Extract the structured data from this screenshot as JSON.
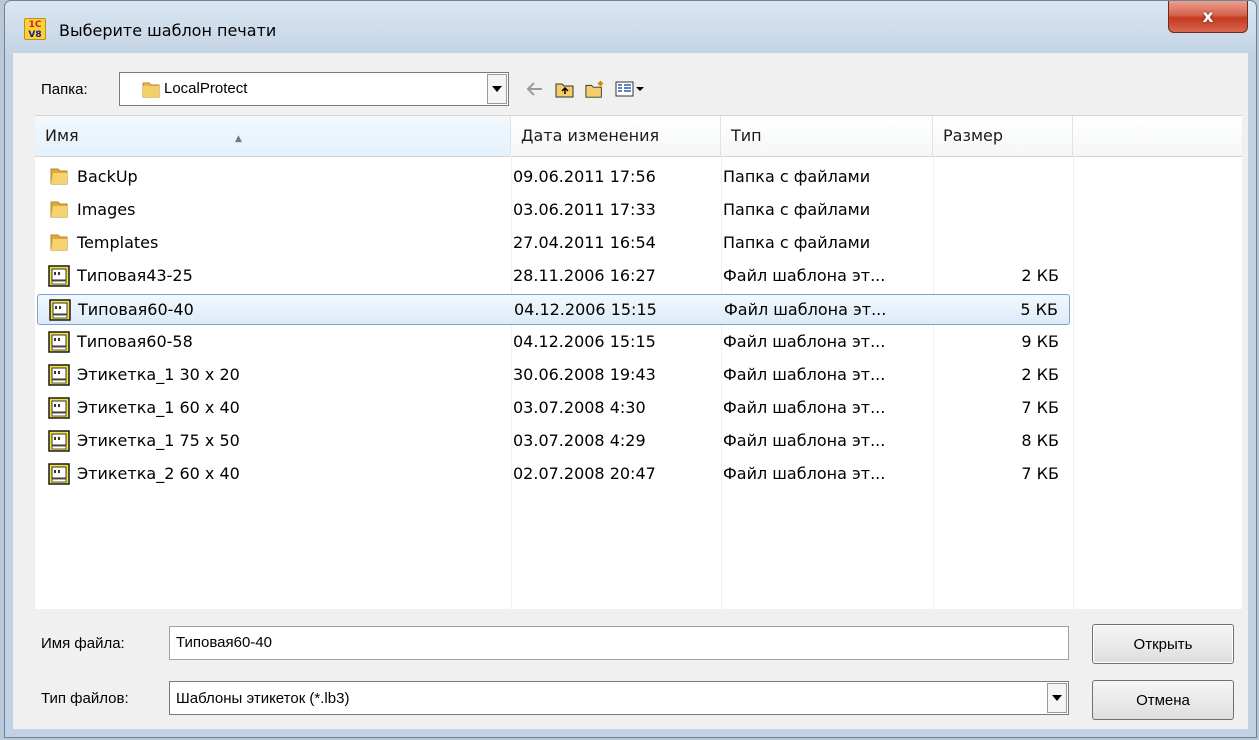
{
  "window": {
    "title": "Выберите шаблон печати",
    "icon_text_top": "1С",
    "icon_text_bottom": "V8",
    "close_label": "x"
  },
  "folder": {
    "label": "Папка:",
    "value": "LocalProtect"
  },
  "toolbar": {
    "icons": [
      "back-arrow-icon",
      "up-folder-icon",
      "new-folder-icon",
      "view-menu-icon"
    ]
  },
  "columns": [
    "Имя",
    "Дата изменения",
    "Тип",
    "Размер"
  ],
  "files": [
    {
      "name": "BackUp",
      "date": "09.06.2011 17:56",
      "type": "Папка с файлами",
      "size": "",
      "kind": "folder"
    },
    {
      "name": "Images",
      "date": "03.06.2011 17:33",
      "type": "Папка с файлами",
      "size": "",
      "kind": "folder"
    },
    {
      "name": "Templates",
      "date": "27.04.2011 16:54",
      "type": "Папка с файлами",
      "size": "",
      "kind": "folder"
    },
    {
      "name": "Типовая43-25",
      "date": "28.11.2006 16:27",
      "type": "Файл шаблона эт...",
      "size": "2 КБ",
      "kind": "file"
    },
    {
      "name": "Типовая60-40",
      "date": "04.12.2006 15:15",
      "type": "Файл шаблона эт...",
      "size": "5 КБ",
      "kind": "file",
      "selected": true
    },
    {
      "name": "Типовая60-58",
      "date": "04.12.2006 15:15",
      "type": "Файл шаблона эт...",
      "size": "9 КБ",
      "kind": "file"
    },
    {
      "name": "Этикетка_1 30 x 20",
      "date": "30.06.2008 19:43",
      "type": "Файл шаблона эт...",
      "size": "2 КБ",
      "kind": "file"
    },
    {
      "name": "Этикетка_1 60 x 40",
      "date": "03.07.2008 4:30",
      "type": "Файл шаблона эт...",
      "size": "7 КБ",
      "kind": "file"
    },
    {
      "name": "Этикетка_1 75 x 50",
      "date": "03.07.2008 4:29",
      "type": "Файл шаблона эт...",
      "size": "8 КБ",
      "kind": "file"
    },
    {
      "name": "Этикетка_2 60 x 40",
      "date": "02.07.2008 20:47",
      "type": "Файл шаблона эт...",
      "size": "7 КБ",
      "kind": "file"
    }
  ],
  "filename": {
    "label": "Имя файла:",
    "value": "Типовая60-40"
  },
  "filetype": {
    "label": "Тип файлов:",
    "value": "Шаблоны этикеток (*.lb3)"
  },
  "buttons": {
    "open": "Открыть",
    "cancel": "Отмена"
  },
  "colors": {
    "selection_border": "#7da2ce",
    "close_button": "#c4391f",
    "folder_yellow": "#e8b64a"
  }
}
